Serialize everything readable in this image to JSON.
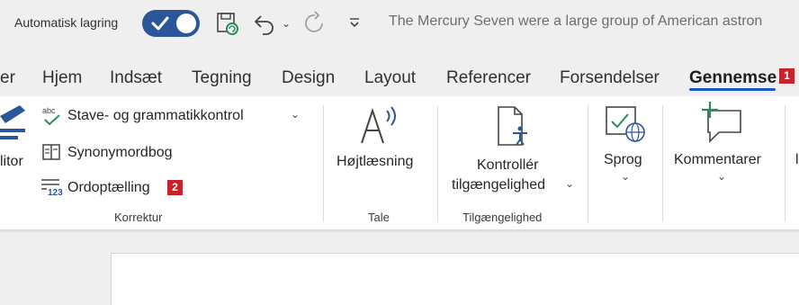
{
  "titlebar": {
    "autosave_label": "Automatisk lagring",
    "autosave_on": true,
    "doc_title": "The Mercury Seven were a large group of American astron"
  },
  "tabs": [
    {
      "label": "er"
    },
    {
      "label": "Hjem"
    },
    {
      "label": "Indsæt"
    },
    {
      "label": "Tegning"
    },
    {
      "label": "Design"
    },
    {
      "label": "Layout"
    },
    {
      "label": "Referencer"
    },
    {
      "label": "Forsendelser"
    },
    {
      "label": "Gennemse",
      "active": true,
      "badge": "1"
    }
  ],
  "ribbon": {
    "editor_label": "litor",
    "proofing": {
      "items": [
        {
          "label": "Stave- og grammatikkontrol",
          "icon": "spellcheck-icon"
        },
        {
          "label": "Synonymordbog",
          "icon": "thesaurus-icon"
        },
        {
          "label": "Ordoptælling",
          "icon": "word-count-icon",
          "badge": "2"
        }
      ],
      "group_label": "Korrektur"
    },
    "speech": {
      "button_label": "Højtlæsning",
      "group_label": "Tale"
    },
    "accessibility": {
      "line1": "Kontrollér",
      "line2": "tilgængelighed",
      "group_label": "Tilgængelighed"
    },
    "language": {
      "button_label": "Sprog"
    },
    "comments": {
      "button_label": "Kommentarer"
    }
  },
  "colors": {
    "accent": "#185abd",
    "toggle": "#2b579a",
    "badge": "#c8222b"
  }
}
